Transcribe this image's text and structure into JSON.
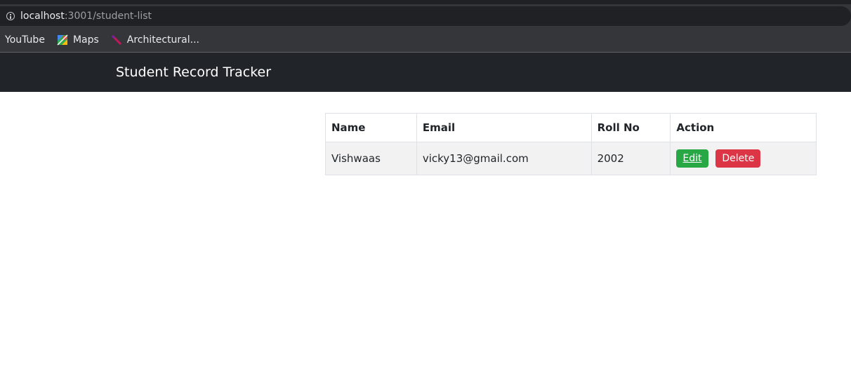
{
  "browser": {
    "url_host": "localhost",
    "url_path": ":3001/student-list",
    "bookmarks": [
      {
        "label": "YouTube",
        "icon": ""
      },
      {
        "label": "Maps",
        "icon": "maps-icon"
      },
      {
        "label": "Architectural...",
        "icon": "pencil-icon"
      }
    ]
  },
  "navbar": {
    "brand": "Student Record Tracker"
  },
  "table": {
    "headers": [
      "Name",
      "Email",
      "Roll No",
      "Action"
    ],
    "rows": [
      {
        "name": "Vishwaas",
        "email": "vicky13@gmail.com",
        "roll_no": "2002",
        "edit_label": "Edit",
        "delete_label": "Delete"
      }
    ]
  },
  "colors": {
    "navbar_bg": "#212529",
    "edit_button": "#28a745",
    "delete_button": "#dc3545"
  }
}
